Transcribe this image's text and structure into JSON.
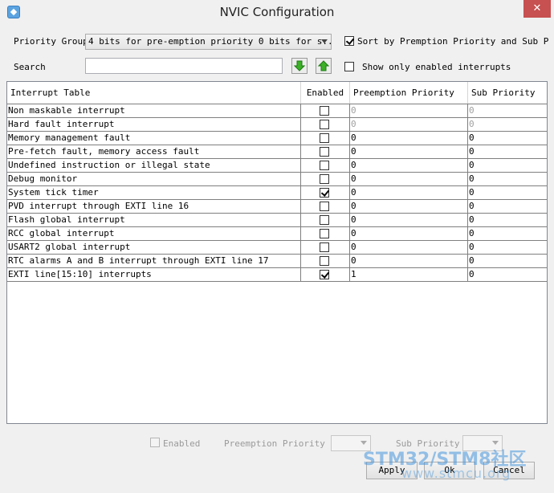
{
  "window": {
    "title": "NVIC Configuration",
    "close_glyph": "✕"
  },
  "toolbar": {
    "priority_group_label": "Priority Group",
    "priority_group_value": "4 bits for pre-emption priority 0 bits for s...",
    "sort_label": "Sort by Premption Priority and Sub Prior",
    "sort_checked": true,
    "search_label": "Search",
    "search_value": "",
    "show_enabled_label": "Show only enabled interrupts",
    "show_enabled_checked": false
  },
  "table": {
    "headers": [
      "Interrupt Table",
      "Enabled",
      "Preemption Priority",
      "Sub Priority"
    ],
    "rows": [
      {
        "name": "Non maskable interrupt",
        "enabled": false,
        "preemption": "0",
        "sub": "0",
        "dim": true
      },
      {
        "name": "Hard fault interrupt",
        "enabled": false,
        "preemption": "0",
        "sub": "0",
        "dim": true
      },
      {
        "name": "Memory management fault",
        "enabled": false,
        "preemption": "0",
        "sub": "0",
        "dim": false
      },
      {
        "name": "Pre-fetch fault, memory access fault",
        "enabled": false,
        "preemption": "0",
        "sub": "0",
        "dim": false
      },
      {
        "name": "Undefined instruction or illegal state",
        "enabled": false,
        "preemption": "0",
        "sub": "0",
        "dim": false
      },
      {
        "name": "Debug monitor",
        "enabled": false,
        "preemption": "0",
        "sub": "0",
        "dim": false
      },
      {
        "name": "System tick timer",
        "enabled": true,
        "preemption": "0",
        "sub": "0",
        "dim": false
      },
      {
        "name": "PVD interrupt through EXTI line 16",
        "enabled": false,
        "preemption": "0",
        "sub": "0",
        "dim": false
      },
      {
        "name": "Flash global interrupt",
        "enabled": false,
        "preemption": "0",
        "sub": "0",
        "dim": false
      },
      {
        "name": "RCC global interrupt",
        "enabled": false,
        "preemption": "0",
        "sub": "0",
        "dim": false
      },
      {
        "name": "USART2 global interrupt",
        "enabled": false,
        "preemption": "0",
        "sub": "0",
        "dim": false
      },
      {
        "name": "RTC alarms A and B interrupt through EXTI line 17",
        "enabled": false,
        "preemption": "0",
        "sub": "0",
        "dim": false
      },
      {
        "name": "EXTI line[15:10] interrupts",
        "enabled": true,
        "preemption": "1",
        "sub": "0",
        "dim": false
      }
    ]
  },
  "bottom": {
    "enabled_label": "Enabled",
    "preemption_label": "Preemption Priority",
    "sub_label": "Sub Priority"
  },
  "buttons": {
    "apply": "Apply",
    "ok": "Ok",
    "cancel": "Cancel"
  },
  "watermark": {
    "main": "STM32/STM8社区",
    "sub": "www.stmcu.org"
  }
}
